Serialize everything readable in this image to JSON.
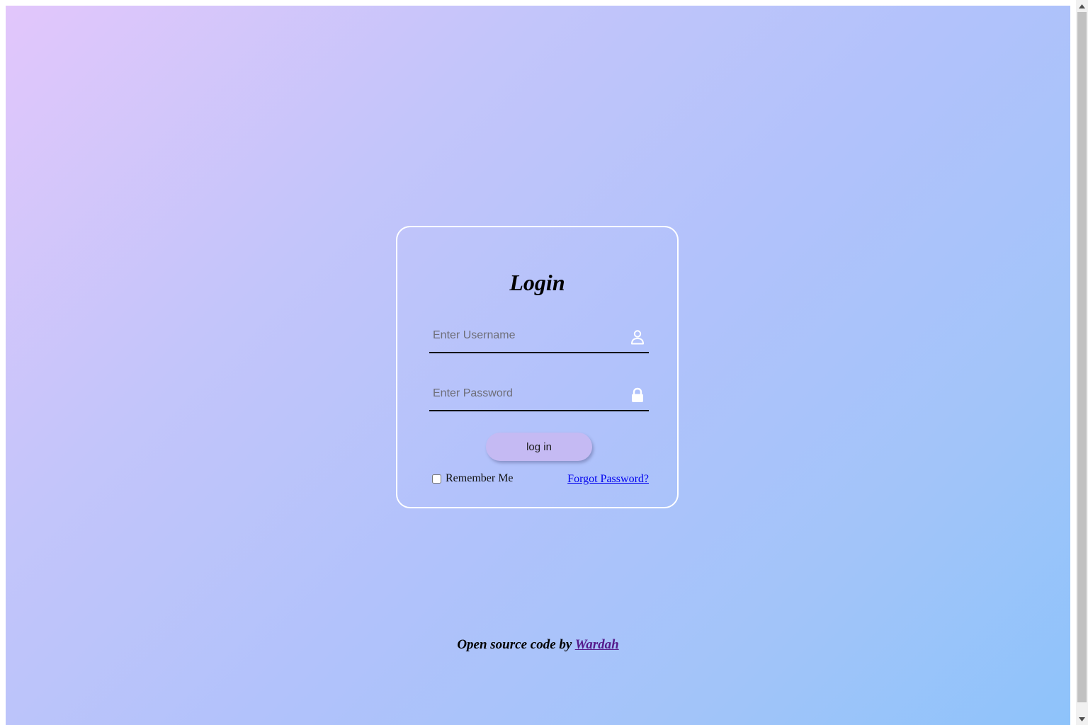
{
  "login": {
    "title": "Login",
    "username": {
      "placeholder": "Enter Username",
      "value": "",
      "icon": "user-icon"
    },
    "password": {
      "placeholder": "Enter Password",
      "value": "",
      "icon": "lock-icon"
    },
    "submit_label": "log in",
    "remember_label": "Remember Me",
    "remember_checked": false,
    "forgot_label": "Forgot Password?"
  },
  "footer": {
    "prefix": "Open source code by ",
    "author_link": "Wardah"
  },
  "colors": {
    "gradient_start": "#e2c6fb",
    "gradient_end": "#8ec3fa",
    "button_bg": "#c5baf3",
    "link": "#0000ee",
    "visited_link": "#551a8b"
  }
}
